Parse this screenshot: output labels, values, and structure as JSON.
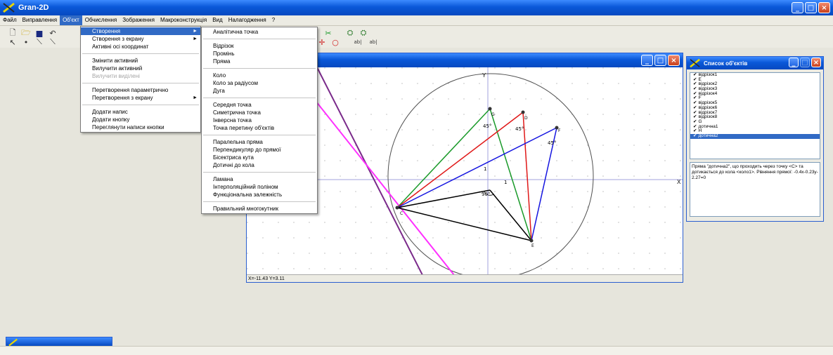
{
  "window": {
    "title": "Gran-2D",
    "minimize": "_",
    "maximize": "□",
    "close": "×"
  },
  "menubar": [
    "Файл",
    "Виправлення",
    "Об'єкт",
    "Обчислення",
    "Зображення",
    "Макроконструкція",
    "Вид",
    "Налагодження",
    "?"
  ],
  "active_menu_index": 2,
  "object_menu": {
    "items": [
      {
        "label": "Створення",
        "arrow": "►",
        "highlight": true
      },
      {
        "label": "Створення з екрану",
        "arrow": "►"
      },
      {
        "label": "Активні осі координат"
      },
      {
        "sep": true
      },
      {
        "label": "Змінити активний"
      },
      {
        "label": "Вилучити активний"
      },
      {
        "label": "Вилучити виділені",
        "disabled": true
      },
      {
        "sep": true
      },
      {
        "label": "Перетворення параметрично"
      },
      {
        "label": "Перетворення з екрану",
        "arrow": "►"
      },
      {
        "sep": true
      },
      {
        "label": "Додати напис"
      },
      {
        "label": "Додати кнопку"
      },
      {
        "label": "Переглянути написи кнопки"
      }
    ]
  },
  "create_submenu": {
    "items": [
      {
        "label": "Аналітична точка"
      },
      {
        "sep": true
      },
      {
        "label": "Відрізок"
      },
      {
        "label": "Промінь"
      },
      {
        "label": "Пряма"
      },
      {
        "sep": true
      },
      {
        "label": "Коло"
      },
      {
        "label": "Коло за радіусом"
      },
      {
        "label": "Дуга"
      },
      {
        "sep": true
      },
      {
        "label": "Середня точка"
      },
      {
        "label": "Симетрична точка"
      },
      {
        "label": "Інверсна точка"
      },
      {
        "label": "Точка перетину об'єктів"
      },
      {
        "sep": true
      },
      {
        "label": "Паралельна пряма"
      },
      {
        "label": "Перпендикуляр до прямої"
      },
      {
        "label": "Бісектриса кута"
      },
      {
        "label": "Дотичні до кола"
      },
      {
        "sep": true
      },
      {
        "label": "Ламана"
      },
      {
        "label": "Інтерполяційний поліном"
      },
      {
        "label": "Функціональна залежність"
      },
      {
        "sep": true
      },
      {
        "label": "Правильний многокутник"
      }
    ]
  },
  "toolbar_icons": [
    "new-icon",
    "open-icon",
    "save-icon",
    "undo-icon"
  ],
  "toolbar2_icons": [
    "pointer-icon",
    "point-icon",
    "segment-icon",
    "line-icon"
  ],
  "toolbar_right_icons": [
    "ab-icon",
    "edit-icon"
  ],
  "graph": {
    "axis_x_label": "X",
    "axis_y_label": "Y",
    "labels": {
      "angle1": "45°",
      "angle2": "45°",
      "angle3": "45°",
      "angle4": "90°",
      "one_x": "1",
      "one_y": "1",
      "pt_g": "G",
      "pt_d": "D",
      "pt_f": "F",
      "pt_c": "C",
      "pt_e": "E"
    },
    "status": "X=-11.43 Y=3.11"
  },
  "objects_window": {
    "title": "Список об'єктів",
    "items": [
      "відрізок1",
      "E",
      "відрізок2",
      "відрізок3",
      "відрізок4",
      "F",
      "відрізок5",
      "відрізок6",
      "відрізок7",
      "відрізок8",
      "G",
      "дотична1",
      "H",
      "дотична2"
    ],
    "selected_index": 13,
    "check": "✔",
    "info": "Пряма \"дотична2\", що проходить через точку <C> та дотикається до кола <коло1>. Рівняння прямої: -0.4x-0.23y-2.27=0"
  },
  "colors": {
    "xp_blue": "#0a58d8",
    "selection": "#316ac5",
    "green": "#1a9a2a",
    "red": "#e01818",
    "blue": "#1515e0",
    "magenta": "#ff2fff",
    "purple": "#7a2a8a"
  }
}
